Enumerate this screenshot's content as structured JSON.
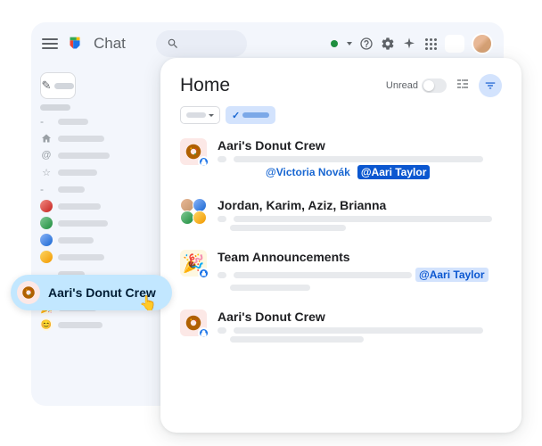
{
  "topbar": {
    "app_title": "Chat"
  },
  "panel": {
    "title": "Home",
    "unread_label": "Unread"
  },
  "threads": [
    {
      "title": "Aari's Donut Crew",
      "mentions": [
        {
          "text": "@Victoria Novák",
          "style": "blue-text"
        },
        {
          "text": "@Aari Taylor",
          "style": "blue-fill"
        }
      ]
    },
    {
      "title": "Jordan, Karim, Aziz, Brianna",
      "mentions": []
    },
    {
      "title": "Team Announcements",
      "mentions": [
        {
          "text": "@Aari Taylor",
          "style": "light-blue"
        }
      ]
    },
    {
      "title": "Aari's Donut Crew",
      "mentions": []
    }
  ],
  "hover": {
    "label": "Aari's Donut Crew"
  }
}
